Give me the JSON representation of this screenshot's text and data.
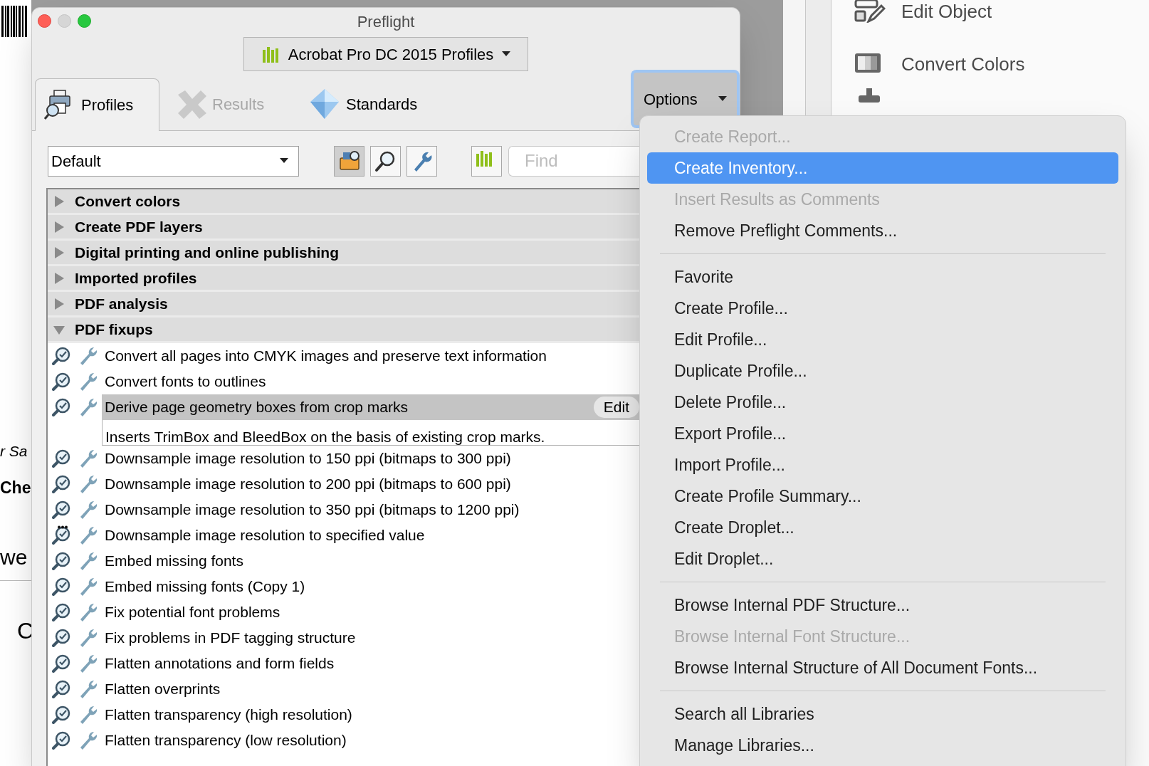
{
  "background": {
    "document_fragments": [
      {
        "text": "r Sa",
        "kind": "italic"
      },
      {
        "text": "Che",
        "kind": "heading"
      },
      {
        "text": "we",
        "kind": "plain"
      },
      {
        "text": "C",
        "kind": "plain"
      }
    ],
    "tools": [
      {
        "label": "Edit Object",
        "kind": "edit"
      },
      {
        "label": "Convert Colors",
        "kind": "colors"
      }
    ]
  },
  "window": {
    "title": "Preflight",
    "library": "Acrobat Pro DC 2015 Profiles",
    "tabs": [
      {
        "label": "Profiles",
        "selected": true,
        "disabled": false
      },
      {
        "label": "Results",
        "selected": false,
        "disabled": true
      },
      {
        "label": "Standards",
        "selected": false,
        "disabled": false
      }
    ],
    "options_button": {
      "label": "Options",
      "selected": true
    },
    "profile_filter": "Default",
    "search": {
      "placeholder": "Find"
    },
    "profile_groups": [
      {
        "label": "Convert colors",
        "expanded": false
      },
      {
        "label": "Create PDF layers",
        "expanded": false
      },
      {
        "label": "Digital printing and online publishing",
        "expanded": false
      },
      {
        "label": "Imported profiles",
        "expanded": false
      },
      {
        "label": "PDF analysis",
        "expanded": false
      },
      {
        "label": "PDF fixups",
        "expanded": true,
        "children": [
          {
            "label": "Convert all pages into CMYK images and preserve text information",
            "kind": "standard",
            "selected": false
          },
          {
            "label": "Convert fonts to outlines",
            "kind": "standard",
            "selected": false
          },
          {
            "label": "Derive page geometry boxes from crop marks",
            "kind": "standard",
            "selected": true,
            "edit_button": "Edit",
            "description": "Inserts TrimBox and BleedBox on the basis of existing crop marks."
          },
          {
            "label": "Downsample image resolution to 150 ppi (bitmaps to 300 ppi)",
            "kind": "standard",
            "selected": false
          },
          {
            "label": "Downsample image resolution to 200 ppi (bitmaps to 600 ppi)",
            "kind": "standard",
            "selected": false
          },
          {
            "label": "Downsample image resolution to 350 ppi (bitmaps to 1200 ppi)",
            "kind": "standard",
            "selected": false
          },
          {
            "label": "Downsample image resolution to specified value",
            "kind": "custom",
            "selected": false
          },
          {
            "label": "Embed missing fonts",
            "kind": "standard",
            "selected": false
          },
          {
            "label": "Embed missing fonts (Copy 1)",
            "kind": "standard",
            "selected": false
          },
          {
            "label": "Fix potential font problems",
            "kind": "standard",
            "selected": false
          },
          {
            "label": "Fix problems in PDF tagging structure",
            "kind": "standard",
            "selected": false
          },
          {
            "label": "Flatten annotations and form fields",
            "kind": "standard",
            "selected": false
          },
          {
            "label": "Flatten overprints",
            "kind": "standard",
            "selected": false
          },
          {
            "label": "Flatten transparency (high resolution)",
            "kind": "standard",
            "selected": false
          },
          {
            "label": "Flatten transparency (low resolution)",
            "kind": "standard",
            "selected": false
          }
        ]
      }
    ]
  },
  "options_menu": [
    {
      "kind": "item",
      "label": "Create Report...",
      "disabled": true,
      "selected": false
    },
    {
      "kind": "item",
      "label": "Create Inventory...",
      "disabled": false,
      "selected": true
    },
    {
      "kind": "item",
      "label": "Insert Results as Comments",
      "disabled": true,
      "selected": false
    },
    {
      "kind": "item",
      "label": "Remove Preflight Comments...",
      "disabled": false,
      "selected": false
    },
    {
      "kind": "separator"
    },
    {
      "kind": "item",
      "label": "Favorite",
      "disabled": false,
      "selected": false
    },
    {
      "kind": "item",
      "label": "Create Profile...",
      "disabled": false,
      "selected": false
    },
    {
      "kind": "item",
      "label": "Edit Profile...",
      "disabled": false,
      "selected": false
    },
    {
      "kind": "item",
      "label": "Duplicate Profile...",
      "disabled": false,
      "selected": false
    },
    {
      "kind": "item",
      "label": "Delete Profile...",
      "disabled": false,
      "selected": false
    },
    {
      "kind": "item",
      "label": "Export Profile...",
      "disabled": false,
      "selected": false
    },
    {
      "kind": "item",
      "label": "Import Profile...",
      "disabled": false,
      "selected": false
    },
    {
      "kind": "item",
      "label": "Create Profile Summary...",
      "disabled": false,
      "selected": false
    },
    {
      "kind": "item",
      "label": "Create Droplet...",
      "disabled": false,
      "selected": false
    },
    {
      "kind": "item",
      "label": "Edit Droplet...",
      "disabled": false,
      "selected": false
    },
    {
      "kind": "separator"
    },
    {
      "kind": "item",
      "label": "Browse Internal PDF Structure...",
      "disabled": false,
      "selected": false
    },
    {
      "kind": "item",
      "label": "Browse Internal Font Structure...",
      "disabled": true,
      "selected": false
    },
    {
      "kind": "item",
      "label": "Browse Internal Structure of All Document Fonts...",
      "disabled": false,
      "selected": false
    },
    {
      "kind": "separator"
    },
    {
      "kind": "item",
      "label": "Search all Libraries",
      "disabled": false,
      "selected": false
    },
    {
      "kind": "item",
      "label": "Manage Libraries...",
      "disabled": false,
      "selected": false
    }
  ]
}
